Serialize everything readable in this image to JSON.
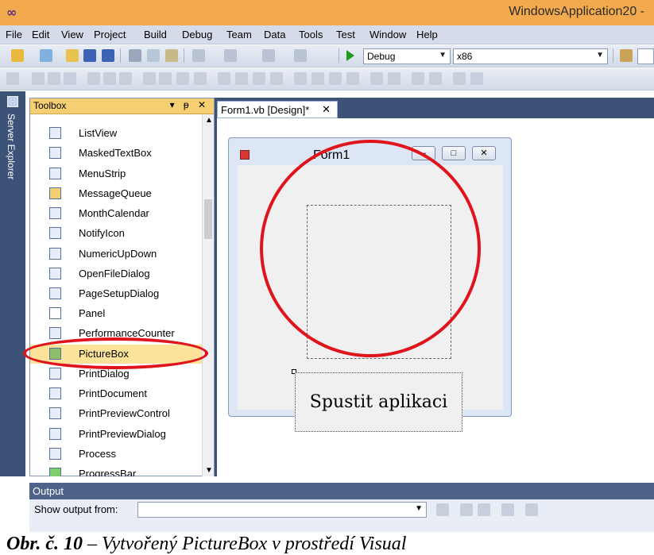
{
  "window": {
    "title": "WindowsApplication20 -",
    "logo_glyph": "∞"
  },
  "menu": [
    "File",
    "Edit",
    "View",
    "Project",
    "Build",
    "Debug",
    "Team",
    "Data",
    "Tools",
    "Test",
    "Window",
    "Help"
  ],
  "toolbar": {
    "config": "Debug",
    "platform": "x86"
  },
  "server_explorer": {
    "label": "Server Explorer"
  },
  "toolbox": {
    "title": "Toolbox",
    "controls": "▾ ᵽ ✕",
    "items": [
      {
        "label": "ListView"
      },
      {
        "label": "MaskedTextBox"
      },
      {
        "label": "MenuStrip"
      },
      {
        "label": "MessageQueue"
      },
      {
        "label": "MonthCalendar"
      },
      {
        "label": "NotifyIcon"
      },
      {
        "label": "NumericUpDown"
      },
      {
        "label": "OpenFileDialog"
      },
      {
        "label": "PageSetupDialog"
      },
      {
        "label": "Panel"
      },
      {
        "label": "PerformanceCounter"
      },
      {
        "label": "PictureBox"
      },
      {
        "label": "PrintDialog"
      },
      {
        "label": "PrintDocument"
      },
      {
        "label": "PrintPreviewControl"
      },
      {
        "label": "PrintPreviewDialog"
      },
      {
        "label": "Process"
      },
      {
        "label": "ProgressBar"
      }
    ],
    "selected": "PictureBox"
  },
  "document_tab": {
    "label": "Form1.vb [Design]*",
    "close": "✕"
  },
  "form": {
    "title": "Form1",
    "button_text": "Spustit aplikaci",
    "btn_min": "–",
    "btn_max": "□",
    "btn_close": "✕"
  },
  "output": {
    "title": "Output",
    "show_from": "Show output from:"
  },
  "caption": {
    "prefix": "Obr. č. 10",
    "text": " – Vytvořený PictureBox v prostředí Visual"
  },
  "colors": {
    "annotation": "#e0141c",
    "titlebar": "#f3a94e",
    "selected": "#fde39a"
  }
}
